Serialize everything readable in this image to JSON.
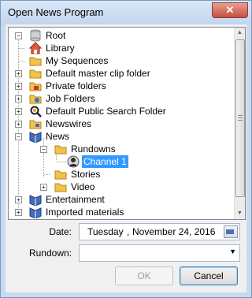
{
  "window": {
    "title": "Open News Program",
    "close_symbol": "✕"
  },
  "tree": {
    "nodes": [
      {
        "label": "Root",
        "icon": "database-icon",
        "expander": "−"
      },
      {
        "label": "Library",
        "icon": "home-icon"
      },
      {
        "label": "My Sequences",
        "icon": "folder-icon"
      },
      {
        "label": "Default master clip folder",
        "icon": "folder-icon",
        "expander": "+"
      },
      {
        "label": "Private folders",
        "icon": "private-folder-icon",
        "expander": "+"
      },
      {
        "label": "Job Folders",
        "icon": "job-folder-icon",
        "expander": "+"
      },
      {
        "label": "Default Public Search Folder",
        "icon": "search-folder-icon",
        "expander": "+"
      },
      {
        "label": "Newswires",
        "icon": "newswire-folder-icon",
        "expander": "+"
      },
      {
        "label": "News",
        "icon": "news-book-icon",
        "expander": "−"
      },
      {
        "label": "Rundowns",
        "icon": "folder-icon",
        "expander": "−"
      },
      {
        "label": "Channel 1",
        "icon": "channel-person-icon",
        "selected": true
      },
      {
        "label": "Stories",
        "icon": "folder-icon"
      },
      {
        "label": "Video",
        "icon": "folder-icon",
        "expander": "+"
      },
      {
        "label": "Entertainment",
        "icon": "news-book-icon",
        "expander": "+"
      },
      {
        "label": "Imported materials",
        "icon": "news-book-icon",
        "expander": "+"
      }
    ]
  },
  "form": {
    "date_label": "Date:",
    "date_weekday": "Tuesday",
    "date_separator": ",",
    "date_value": "November 24, 2016",
    "rundown_label": "Rundown:",
    "rundown_value": ""
  },
  "buttons": {
    "ok": "OK",
    "cancel": "Cancel"
  },
  "colors": {
    "selection": "#3399ff",
    "folder": "#f2c14e",
    "book": "#3a6fc4"
  }
}
